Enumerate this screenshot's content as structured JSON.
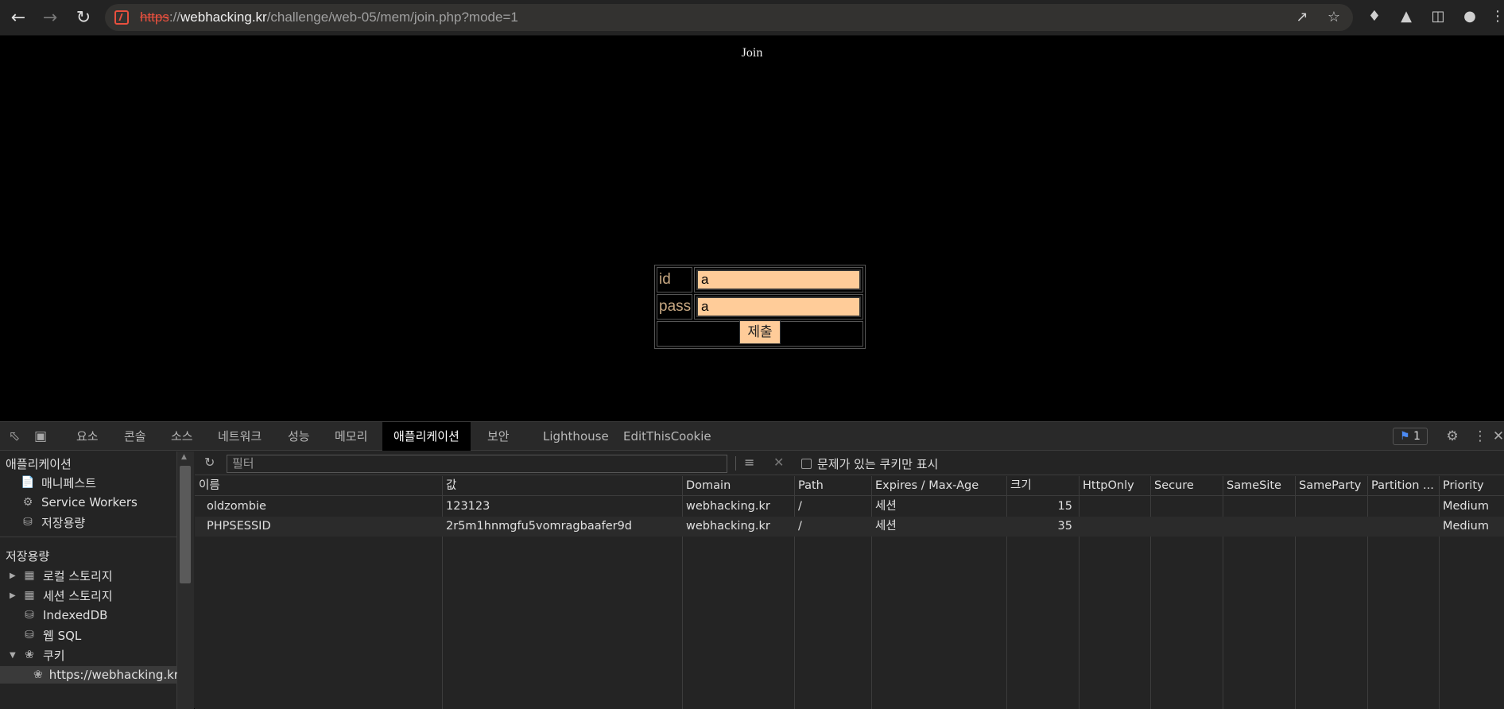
{
  "browser": {
    "url_scheme": "https",
    "url_sep": "://",
    "url_host": "webhacking.kr",
    "url_path": "/challenge/web-05/mem/join.php?mode=1",
    "icons": {
      "back": "back-arrow-icon",
      "forward": "forward-arrow-icon",
      "reload": "reload-icon",
      "share": "share-icon",
      "bookmark": "star-icon",
      "extensions": "puzzle-icon",
      "labs": "flask-icon",
      "sidepanel": "side-panel-icon",
      "profile": "profile-icon",
      "menu": "kebab-menu-icon"
    }
  },
  "page": {
    "title": "Join",
    "form": {
      "id_label": "id",
      "id_value": "a",
      "pass_label": "pass",
      "pass_value": "a",
      "submit_label": "제출"
    }
  },
  "devtools": {
    "tabs": [
      "요소",
      "콘솔",
      "소스",
      "네트워크",
      "성능",
      "메모리",
      "애플리케이션",
      "보안",
      "Lighthouse",
      "EditThisCookie"
    ],
    "active_tab": "애플리케이션",
    "issues_count": "1",
    "sidebar": {
      "app_section": "애플리케이션",
      "app_items": [
        "매니페스트",
        "Service Workers",
        "저장용량"
      ],
      "storage_section": "저장용량",
      "storage_items": [
        "로컬 스토리지",
        "세션 스토리지",
        "IndexedDB",
        "웹 SQL",
        "쿠키"
      ],
      "cookie_origin": "https://webhacking.kr"
    },
    "cookies": {
      "filter_placeholder": "필터",
      "only_issues_label": "문제가 있는 쿠키만 표시",
      "columns": [
        "이름",
        "값",
        "Domain",
        "Path",
        "Expires / Max-Age",
        "크기",
        "HttpOnly",
        "Secure",
        "SameSite",
        "SameParty",
        "Partition ...",
        "Priority"
      ],
      "rows": [
        [
          "oldzombie",
          "123123",
          "webhacking.kr",
          "/",
          "세션",
          "15",
          "",
          "",
          "",
          "",
          "",
          "Medium"
        ],
        [
          "PHPSESSID",
          "2r5m1hnmgfu5vomragbaafer9d",
          "webhacking.kr",
          "/",
          "세션",
          "35",
          "",
          "",
          "",
          "",
          "",
          "Medium"
        ]
      ]
    }
  }
}
